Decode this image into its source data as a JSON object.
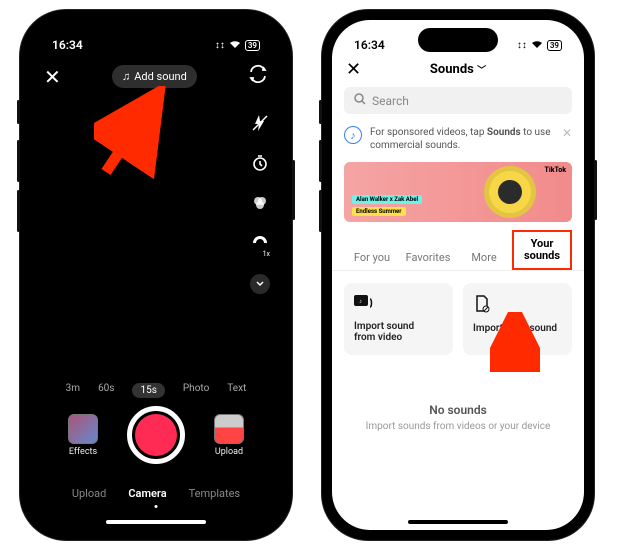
{
  "phone1": {
    "status_time": "16:34",
    "status_battery": "39",
    "close": "✕",
    "add_sound": "Add sound",
    "durations": [
      "3m",
      "60s",
      "15s",
      "Photo",
      "Text"
    ],
    "duration_active_index": 2,
    "effects_label": "Effects",
    "upload_label": "Upload",
    "modes": [
      "Upload",
      "Camera",
      "Templates"
    ],
    "mode_active_index": 1
  },
  "phone2": {
    "status_time": "16:34",
    "status_battery": "39",
    "close": "✕",
    "title": "Sounds",
    "search_placeholder": "Search",
    "info_text_1": "For sponsored videos, tap ",
    "info_text_bold": "Sounds",
    "info_text_2": " to use commercial sounds.",
    "banner_pill1": "Alan Walker x Zak Abel",
    "banner_pill2": "Endless Summer",
    "banner_brand": "TikTok",
    "tabs": [
      "For you",
      "Favorites",
      "More"
    ],
    "tab_yours_line1": "Your",
    "tab_yours_line2": "sounds",
    "import_video_line1": "Import sound",
    "import_video_line2": "from video",
    "import_local": "Import local sound",
    "nosounds_title": "No sounds",
    "nosounds_sub": "Import sounds from videos or your device"
  }
}
